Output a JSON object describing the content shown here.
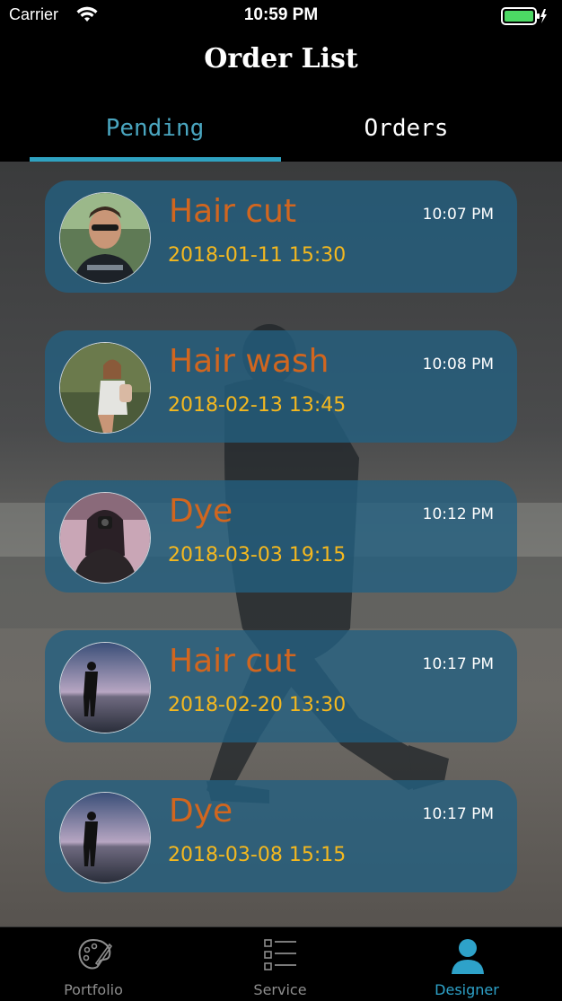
{
  "status_bar": {
    "carrier": "Carrier",
    "time": "10:59 PM"
  },
  "header": {
    "title": "Order List"
  },
  "tabs": [
    {
      "label": "Pending",
      "active": true
    },
    {
      "label": "Orders",
      "active": false
    }
  ],
  "orders": [
    {
      "service": "Hair cut",
      "datetime": "2018-01-11 15:30",
      "time": "10:07 PM",
      "avatar": "young-man-sunglasses"
    },
    {
      "service": "Hair wash",
      "datetime": "2018-02-13 13:45",
      "time": "10:08 PM",
      "avatar": "woman-backpack"
    },
    {
      "service": "Dye",
      "datetime": "2018-03-03 19:15",
      "time": "10:12 PM",
      "avatar": "woman-camera"
    },
    {
      "service": "Hair cut",
      "datetime": "2018-02-20 13:30",
      "time": "10:17 PM",
      "avatar": "silhouette-sea"
    },
    {
      "service": "Dye",
      "datetime": "2018-03-08 15:15",
      "time": "10:17 PM",
      "avatar": "silhouette-sea"
    }
  ],
  "tabbar": [
    {
      "label": "Portfolio",
      "icon": "palette-icon",
      "active": false
    },
    {
      "label": "Service",
      "icon": "list-icon",
      "active": false
    },
    {
      "label": "Designer",
      "icon": "person-icon",
      "active": true
    }
  ],
  "colors": {
    "accent": "#2fa2c1",
    "service_text": "#d1661f",
    "date_text": "#f4b81f",
    "card_bg": "#226082"
  }
}
